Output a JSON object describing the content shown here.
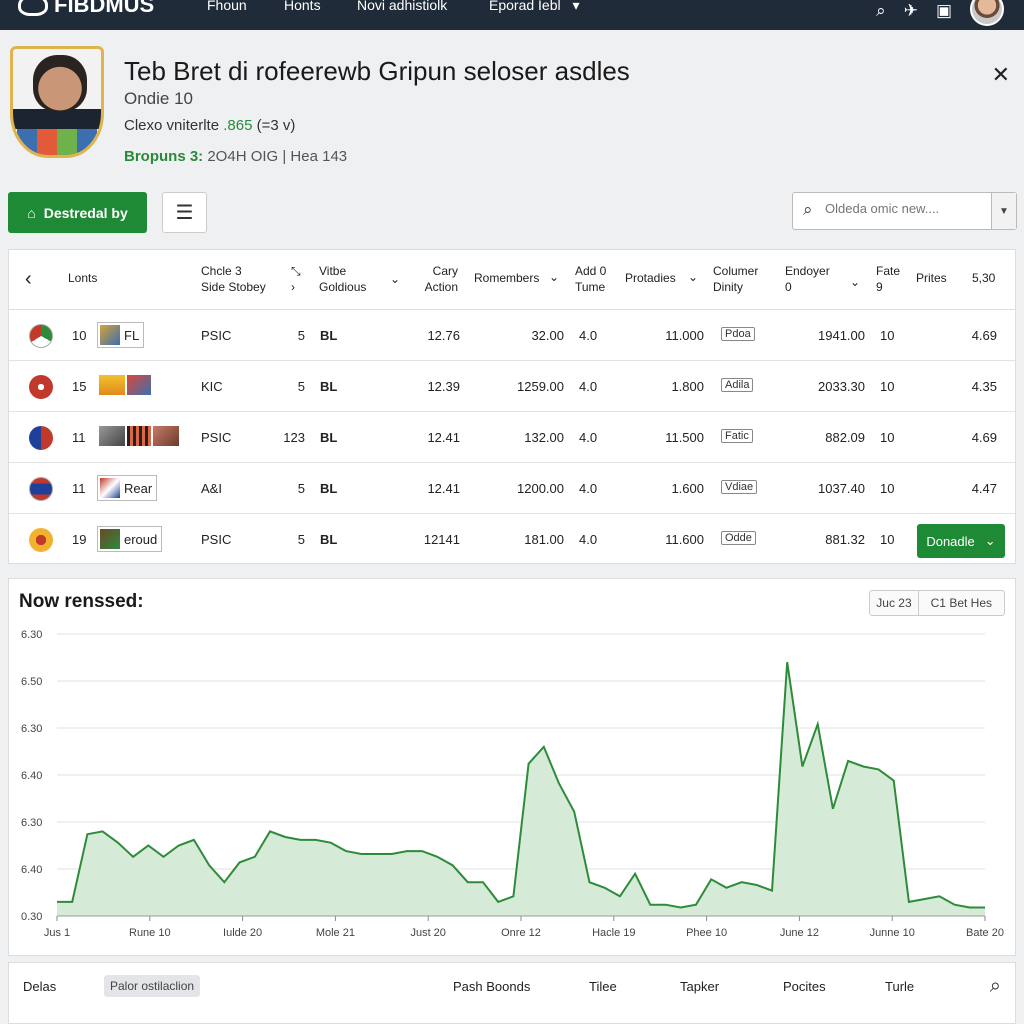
{
  "nav": {
    "brand": "FIBDMUS",
    "links": [
      "Fhoun",
      "Honts",
      "Novi adhistiolk",
      "Eporad Iebl"
    ],
    "link_dropdown": "▾"
  },
  "header": {
    "title": "Teb Bret di rofeerewb Gripun seloser asdles",
    "subtitle": "Ondie 10",
    "line3_prefix": "Clexo vniterlte",
    "line3_value": ".865",
    "line3_suffix": "(=3 v)",
    "line4_strong": "Bropuns 3:",
    "line4_rest": "2O4H OIG  |  Hea 143",
    "close": "✕"
  },
  "toolbar": {
    "primary_label": "Destredal by",
    "search_placeholder": "Oldeda omic new...."
  },
  "table": {
    "headers": {
      "h1": "Lonts",
      "h2a": "Chcle 3",
      "h2b": "Side Stobey",
      "h3a": "Vitbe",
      "h3b": "Goldious",
      "h4a": "Cary",
      "h4b": "Action",
      "h5": "Romembers",
      "h6a": "Add 0",
      "h6b": "Tume",
      "h7": "Protadies",
      "h8a": "Columer",
      "h8b": "Dinity",
      "h9a": "Endoyer",
      "h9b": "0",
      "h10a": "Fate",
      "h10b": "9",
      "h11": "Prites",
      "h12": "5,30"
    },
    "rows": [
      {
        "rank": "10",
        "badge": "FL",
        "code": "PSIC",
        "n": "5",
        "t": "BL",
        "a": "12.76",
        "b": "32.00",
        "c": "4.0",
        "d": "11.000",
        "tag": "Pdoa",
        "e": "1941.00",
        "f": "10",
        "g": "4.69"
      },
      {
        "rank": "15",
        "badge": "",
        "code": "KIC",
        "n": "5",
        "t": "BL",
        "a": "12.39",
        "b": "1259.00",
        "c": "4.0",
        "d": "1.800",
        "tag": "Adila",
        "e": "2033.30",
        "f": "10",
        "g": "4.35"
      },
      {
        "rank": "11",
        "badge": "",
        "code": "PSIC",
        "n": "123",
        "t": "BL",
        "a": "12.41",
        "b": "132.00",
        "c": "4.0",
        "d": "11.500",
        "tag": "Fatic",
        "e": "882.09",
        "f": "10",
        "g": "4.69"
      },
      {
        "rank": "11",
        "badge": "Rear",
        "code": "A&I",
        "n": "5",
        "t": "BL",
        "a": "12.41",
        "b": "1200.00",
        "c": "4.0",
        "d": "1.600",
        "tag": "Vdiae",
        "e": "1037.40",
        "f": "10",
        "g": "4.47"
      },
      {
        "rank": "19",
        "badge": "eroud",
        "code": "PSIC",
        "n": "5",
        "t": "BL",
        "a": "12141",
        "b": "181.00",
        "c": "4.0",
        "d": "11.600",
        "tag": "Odde",
        "e": "881.32",
        "f": "10",
        "g": "",
        "button": "Donadle"
      }
    ]
  },
  "chart_panel": {
    "title": "Now renssed:",
    "date_a": "Juc 23",
    "date_b": "C1 Bet Hes"
  },
  "chart_data": {
    "type": "area",
    "y_ticks": [
      "6.30",
      "6.50",
      "6.30",
      "6.40",
      "6.30",
      "6.40",
      "0.30"
    ],
    "x_ticks": [
      "Jus 1",
      "Rune 10",
      "Iulde 20",
      "Mole 21",
      "Just 20",
      "Onre 12",
      "Hacle 19",
      "Phee 10",
      "June 12",
      "Junne 10",
      "Bate 20"
    ],
    "values": [
      0.05,
      0.05,
      0.29,
      0.3,
      0.26,
      0.21,
      0.25,
      0.21,
      0.25,
      0.27,
      0.18,
      0.12,
      0.19,
      0.21,
      0.3,
      0.28,
      0.27,
      0.27,
      0.26,
      0.23,
      0.22,
      0.22,
      0.22,
      0.23,
      0.23,
      0.21,
      0.18,
      0.12,
      0.12,
      0.05,
      0.07,
      0.54,
      0.6,
      0.47,
      0.37,
      0.12,
      0.1,
      0.07,
      0.15,
      0.04,
      0.04,
      0.03,
      0.04,
      0.13,
      0.1,
      0.12,
      0.11,
      0.09,
      0.9,
      0.53,
      0.68,
      0.38,
      0.55,
      0.53,
      0.52,
      0.48,
      0.05,
      0.06,
      0.07,
      0.04,
      0.03,
      0.03
    ],
    "ylim": [
      0,
      1
    ],
    "colors": {
      "line": "#2e8b3a",
      "fill": "#d6ead8"
    }
  },
  "bottom": {
    "col1": "Delas",
    "pill": "Palor ostilaclion",
    "col2": "Pash Boonds",
    "col3": "Tilee",
    "col4": "Tapker",
    "col5": "Pocites",
    "col6": "Turle"
  },
  "icons": {
    "search": "⌕",
    "bell": "✈",
    "message": "▣",
    "close": "✕",
    "menu": "☰",
    "back": "‹",
    "home": "⌂",
    "chevron": "⌄"
  }
}
